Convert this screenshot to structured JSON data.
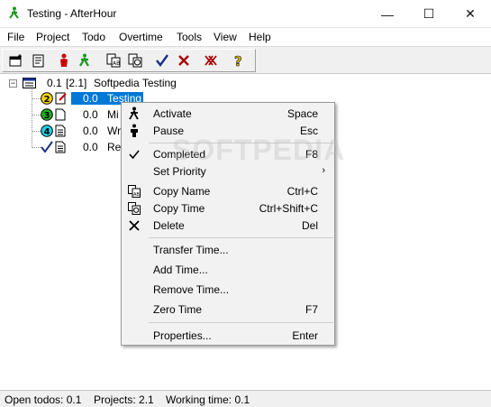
{
  "window": {
    "title": "Testing - AfterHour",
    "icon": "walking-man-icon",
    "minimize": "—",
    "maximize": "☐",
    "close": "✕"
  },
  "menubar": [
    "File",
    "Project",
    "Todo",
    "Overtime",
    "Tools",
    "View",
    "Help"
  ],
  "toolbar": {
    "icons": [
      "new-project-icon",
      "properties-icon",
      "stop-icon",
      "activate-icon",
      "copy-name-icon",
      "copy-time-icon",
      "complete-icon",
      "delete-icon",
      "delete-all-icon",
      "help-icon"
    ]
  },
  "tree": {
    "root": {
      "time": "0.1",
      "count": "[2.1]",
      "name": "Softpedia Testing"
    },
    "items": [
      {
        "badge": "2",
        "time": "0.0",
        "name": "Testing",
        "selected": true
      },
      {
        "badge": "3",
        "time": "0.0",
        "name": "Mi"
      },
      {
        "badge": "4",
        "time": "0.0",
        "name": "Wr"
      },
      {
        "badge": "check",
        "time": "0.0",
        "name": "Re"
      }
    ]
  },
  "watermark": "SOFTPEDIA",
  "context_menu": {
    "items": [
      {
        "label": "Activate",
        "shortcut": "Space",
        "icon": "walking-man-icon"
      },
      {
        "label": "Pause",
        "shortcut": "Esc",
        "icon": "standing-man-icon"
      },
      {
        "label": "Completed",
        "shortcut": "F8",
        "icon": "check-icon"
      },
      {
        "label": "Set Priority",
        "shortcut": "",
        "submenu": "›"
      },
      {
        "label": "Copy Name",
        "shortcut": "Ctrl+C",
        "icon": "copy-name-icon"
      },
      {
        "label": "Copy Time",
        "shortcut": "Ctrl+Shift+C",
        "icon": "copy-time-icon"
      },
      {
        "label": "Delete",
        "shortcut": "Del",
        "icon": "delete-icon"
      },
      {
        "label": "Transfer Time...",
        "shortcut": ""
      },
      {
        "label": "Add Time...",
        "shortcut": ""
      },
      {
        "label": "Remove Time...",
        "shortcut": ""
      },
      {
        "label": "Zero Time",
        "shortcut": "F7"
      },
      {
        "label": "Properties...",
        "shortcut": "Enter"
      }
    ]
  },
  "statusbar": {
    "open_todos": "Open todos: 0.1",
    "projects": "Projects: 2.1",
    "working_time": "Working time: 0.1"
  },
  "colors": {
    "selection": "#0078d7",
    "accent_green": "#2e9e2e"
  }
}
